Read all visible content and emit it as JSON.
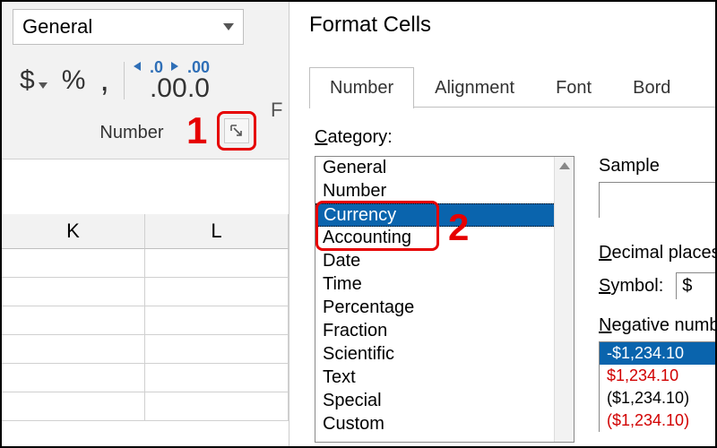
{
  "ribbon": {
    "format_selected": "General",
    "currency_btn": "$",
    "percent_btn": "%",
    "thousands_btn": ",",
    "inc_dec_top": ".0",
    "inc_dec_bot": ".00",
    "dec_inc_top": ".00",
    "dec_inc_bot": ".0",
    "group_label": "Number",
    "columns": [
      "K",
      "L"
    ],
    "partial_char": "F"
  },
  "dialog": {
    "title": "Format Cells",
    "tabs": [
      "Number",
      "Alignment",
      "Font",
      "Bord"
    ],
    "active_tab": 0,
    "category_label_pre": "C",
    "category_label_rest": "ategory:",
    "categories": [
      "General",
      "Number",
      "Currency",
      "Accounting",
      "Date",
      "Time",
      "Percentage",
      "Fraction",
      "Scientific",
      "Text",
      "Special",
      "Custom"
    ],
    "selected_category": 2,
    "sample_label": "Sample",
    "decimal_label_pre": "D",
    "decimal_label_rest": "ecimal places",
    "symbol_label_pre": "S",
    "symbol_label_rest": "ymbol:",
    "symbol_value": "$",
    "negative_label_pre": "N",
    "negative_label_rest": "egative numb",
    "negative_numbers": [
      {
        "text": "-$1,234.10",
        "style": "sel"
      },
      {
        "text": "$1,234.10",
        "style": "red"
      },
      {
        "text": "($1,234.10)",
        "style": ""
      },
      {
        "text": "($1,234.10)",
        "style": "red"
      }
    ]
  },
  "annotations": {
    "step1": "1",
    "step2": "2"
  }
}
